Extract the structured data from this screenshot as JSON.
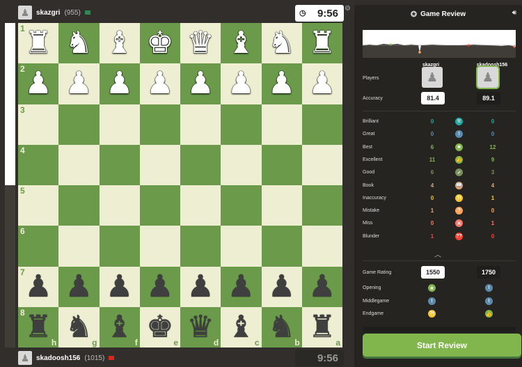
{
  "top_player": {
    "name": "skazgri",
    "rating": "(955)",
    "clock": "9:56",
    "flag_color": "#2e8b57"
  },
  "bottom_player": {
    "name": "skadoosh156",
    "rating": "(1015)",
    "clock": "9:56",
    "flag_color": "#d52b1e"
  },
  "eval_bar": {
    "white_fraction": 0.5
  },
  "board": {
    "ranks": [
      "1",
      "2",
      "3",
      "4",
      "5",
      "6",
      "7",
      "8"
    ],
    "files": [
      "h",
      "g",
      "f",
      "e",
      "d",
      "c",
      "b",
      "a"
    ],
    "rows": [
      [
        "♜",
        "♞",
        "♝",
        "♚",
        "♛",
        "♝",
        "♞",
        "♜"
      ],
      [
        "♟",
        "♟",
        "♟",
        "♟",
        "♟",
        "♟",
        "♟",
        "♟"
      ],
      [
        "",
        "",
        "",
        "",
        "",
        "",
        "",
        ""
      ],
      [
        "",
        "",
        "",
        "",
        "",
        "",
        "",
        ""
      ],
      [
        "",
        "",
        "",
        "",
        "",
        "",
        "",
        ""
      ],
      [
        "",
        "",
        "",
        "",
        "",
        "",
        "",
        ""
      ],
      [
        "♟",
        "♟",
        "♟",
        "♟",
        "♟",
        "♟",
        "♟",
        "♟"
      ],
      [
        "♜",
        "♞",
        "♝",
        "♚",
        "♛",
        "♝",
        "♞",
        "♜"
      ]
    ],
    "row_colors": [
      "white",
      "white",
      "",
      "",
      "",
      "",
      "black",
      "black"
    ]
  },
  "panel": {
    "title": "Game Review",
    "title_icon": "star-icon",
    "sound_icon": "speaker-icon",
    "settings_icon": "gear-icon",
    "white_name": "skazgri",
    "black_name": "skadoosh156",
    "players_label": "Players",
    "accuracy_label": "Accuracy",
    "white_accuracy": "81.4",
    "black_accuracy": "89.1",
    "classifications": [
      {
        "label": "Brilliant",
        "white": "0",
        "black": "0",
        "symbol": "!!",
        "color": "#1baca6"
      },
      {
        "label": "Great",
        "white": "0",
        "black": "0",
        "symbol": "!",
        "color": "#5c8bb0"
      },
      {
        "label": "Best",
        "white": "6",
        "black": "12",
        "symbol": "★",
        "color": "#81b64c"
      },
      {
        "label": "Excellent",
        "white": "11",
        "black": "9",
        "symbol": "👍",
        "color": "#81b64c"
      },
      {
        "label": "Good",
        "white": "6",
        "black": "3",
        "symbol": "✓",
        "color": "#77915f"
      },
      {
        "label": "Book",
        "white": "4",
        "black": "4",
        "symbol": "📖",
        "color": "#d5a47d"
      },
      {
        "label": "Inaccuracy",
        "white": "0",
        "black": "1",
        "symbol": "?!",
        "color": "#f7c631"
      },
      {
        "label": "Mistake",
        "white": "1",
        "black": "0",
        "symbol": "?",
        "color": "#ffa459"
      },
      {
        "label": "Miss",
        "white": "0",
        "black": "1",
        "symbol": "✕",
        "color": "#ff7769"
      },
      {
        "label": "Blunder",
        "white": "1",
        "black": "0",
        "symbol": "??",
        "color": "#fa412d"
      }
    ],
    "game_rating_label": "Game Rating",
    "white_game_rating": "1550",
    "black_game_rating": "1750",
    "phases": [
      {
        "label": "Opening",
        "white_symbol": "★",
        "white_color": "#81b64c",
        "black_symbol": "!",
        "black_color": "#5c8bb0"
      },
      {
        "label": "Middlegame",
        "white_symbol": "!",
        "white_color": "#5c8bb0",
        "black_symbol": "!",
        "black_color": "#5c8bb0"
      },
      {
        "label": "Endgame",
        "white_symbol": "?!",
        "white_color": "#f7c631",
        "black_symbol": "👍",
        "black_color": "#81b64c"
      }
    ],
    "start_button": "Start Review"
  }
}
